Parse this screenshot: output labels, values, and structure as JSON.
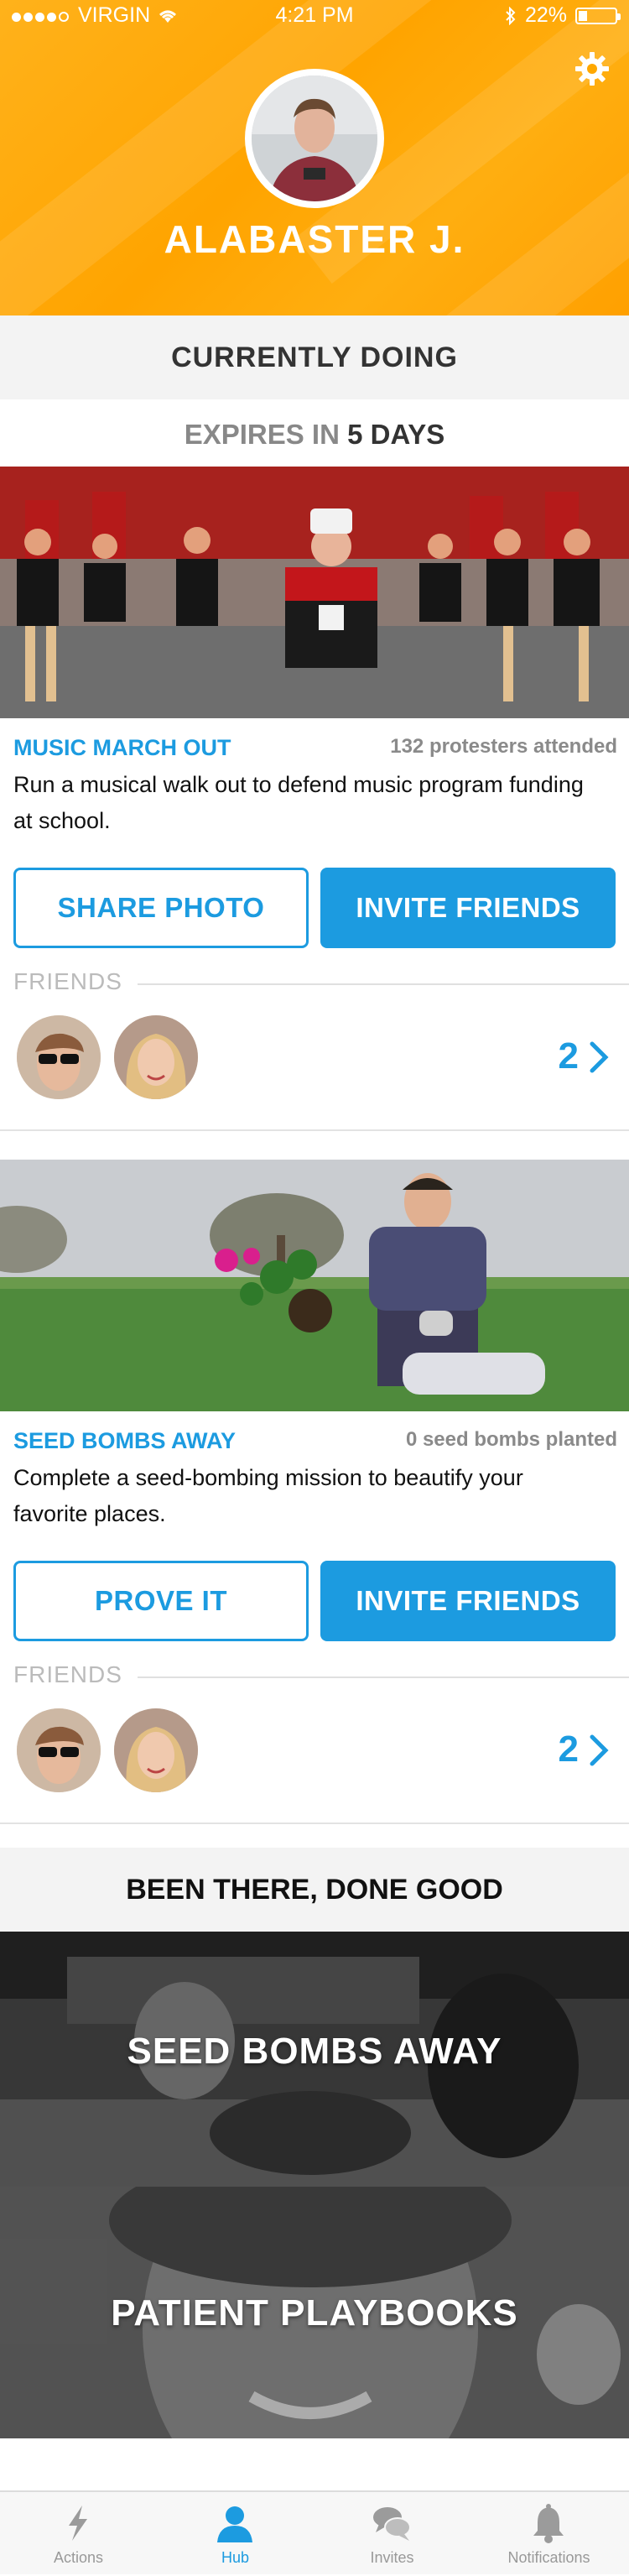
{
  "status": {
    "carrier": "VIRGIN",
    "time": "4:21 PM",
    "battery": "22%"
  },
  "profile": {
    "name": "ALABASTER J."
  },
  "current": {
    "section_title": "CURRENTLY DOING",
    "expires_prefix": "EXPIRES IN",
    "expires_value": "5 DAYS"
  },
  "cards": [
    {
      "title": "MUSIC MARCH OUT",
      "meta": "132 protesters attended",
      "desc": "Run a musical walk out to defend music program funding at school.",
      "primary": "SHARE PHOTO",
      "secondary": "INVITE FRIENDS",
      "friends_label": "FRIENDS",
      "friends_count": "2"
    },
    {
      "title": "SEED BOMBS AWAY",
      "meta": "0 seed bombs planted",
      "desc": "Complete a seed-bombing mission to beautify your favorite places.",
      "primary": "PROVE IT",
      "secondary": "INVITE FRIENDS",
      "friends_label": "FRIENDS",
      "friends_count": "2"
    }
  ],
  "done": {
    "title": "BEEN THERE, DONE GOOD",
    "items": [
      "SEED BOMBS AWAY",
      "PATIENT PLAYBOOKS"
    ]
  },
  "tabs": [
    {
      "label": "Actions",
      "icon": "lightning-icon"
    },
    {
      "label": "Hub",
      "icon": "person-icon"
    },
    {
      "label": "Invites",
      "icon": "chat-bubbles-icon"
    },
    {
      "label": "Notifications",
      "icon": "bell-icon"
    }
  ],
  "colors": {
    "accent": "#1c9be0",
    "header": "#ffa800"
  }
}
